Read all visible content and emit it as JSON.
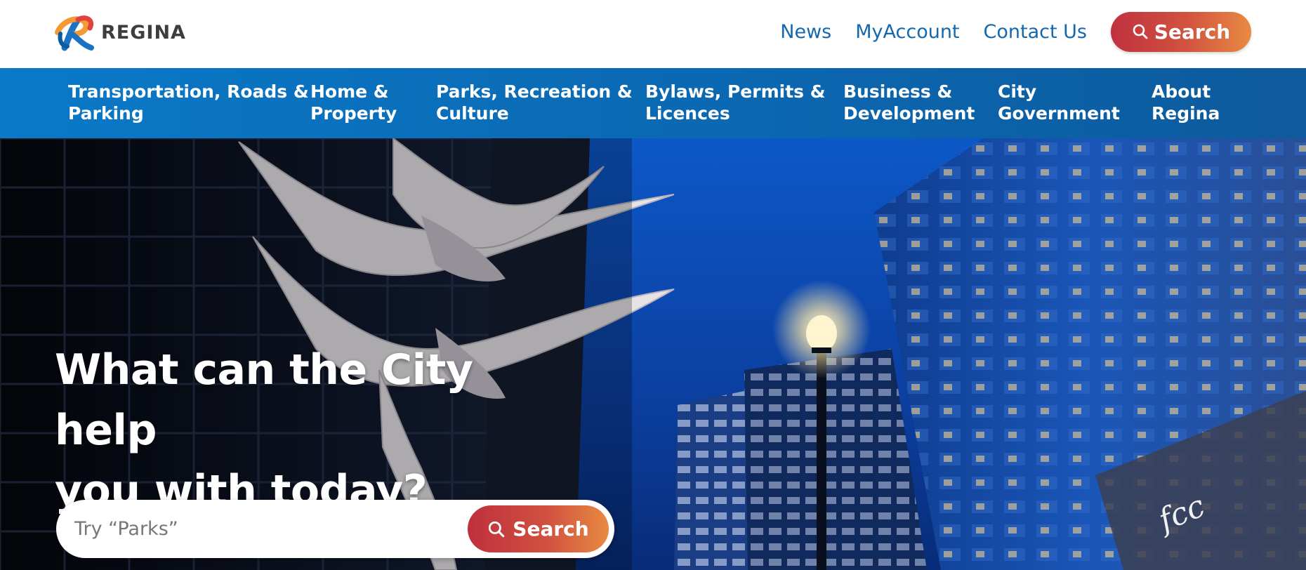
{
  "header": {
    "logo_text": "REGINA",
    "links": [
      "News",
      "MyAccount",
      "Contact Us"
    ],
    "search_button": "Search",
    "colors": {
      "link": "#1468b0",
      "search_gradient_start": "#c0313f",
      "search_gradient_end": "#e88a42"
    }
  },
  "nav": {
    "items": [
      {
        "line1": "Transportation, Roads &",
        "line2": "Parking"
      },
      {
        "line1": "Home &",
        "line2": "Property"
      },
      {
        "line1": "Parks, Recreation &",
        "line2": "Culture"
      },
      {
        "line1": "Bylaws, Permits &",
        "line2": "Licences"
      },
      {
        "line1": "Business &",
        "line2": "Development"
      },
      {
        "line1": "City",
        "line2": "Government"
      },
      {
        "line1": "About",
        "line2": "Regina"
      }
    ],
    "colors": {
      "background": "#0b6bb5",
      "text": "#ffffff"
    }
  },
  "hero": {
    "title_line1": "What can the City help",
    "title_line2": "you with today?",
    "search_placeholder": "Try “Parks”",
    "search_button": "Search",
    "image_alt": "fcc",
    "icons": [
      "search-icon"
    ]
  }
}
